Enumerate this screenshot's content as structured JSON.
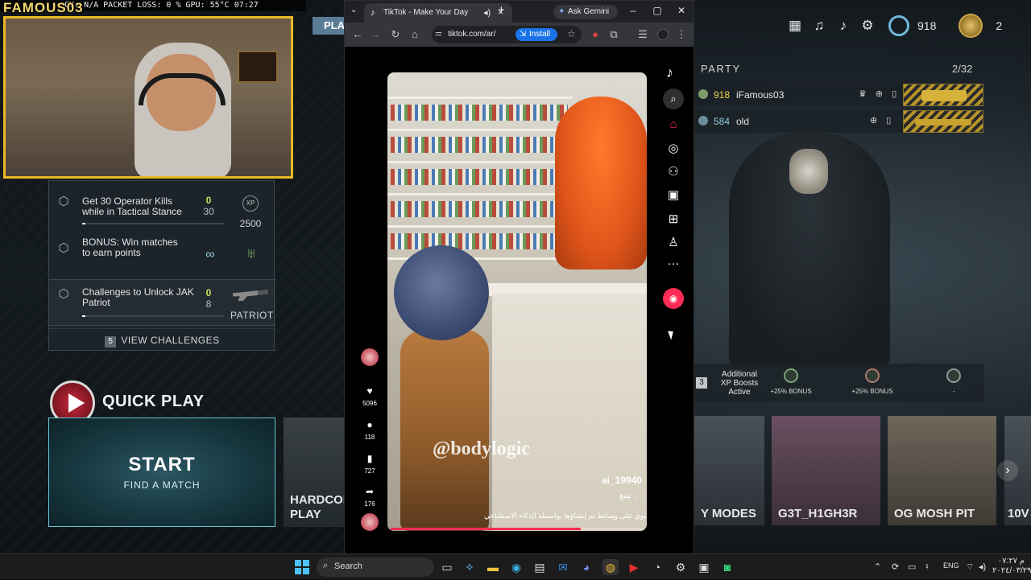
{
  "stream": {
    "stats": "CY: N/A    PACKET LOSS: 0 %    GPU: 55°C    07:27",
    "streamer": "FAMOUS03",
    "play_tab": "PLAY"
  },
  "challenges": {
    "items": [
      {
        "title": "Get 30 Operator Kills while in Tactical Stance",
        "current": "0",
        "total": "30",
        "reward": "2500"
      },
      {
        "title": "BONUS: Win matches to earn points",
        "current": "",
        "total": "",
        "reward": "∞"
      },
      {
        "title": "Challenges to Unlock JAK Patriot",
        "current": "0",
        "total": "8",
        "reward": "PATRIOT"
      }
    ],
    "view_count": "5",
    "view_label": "VIEW CHALLENGES"
  },
  "quick_play": {
    "title": "QUICK PLAY",
    "start": "START",
    "sub": "FIND A MATCH",
    "hardcore": "HARDCORE PLAY"
  },
  "hud": {
    "level": "918",
    "prestige": "2"
  },
  "party": {
    "label": "PARTY",
    "count": "2/32",
    "members": [
      {
        "level": "918",
        "name": "iFamous03"
      },
      {
        "level": "584",
        "name": "old"
      }
    ]
  },
  "xp_boosts": {
    "count": "3",
    "label": "Additional XP Boosts Active",
    "slots": [
      "+25% BONUS",
      "+25% BONUS",
      "-"
    ]
  },
  "playlists": [
    "Y MODES",
    "G3T_H1GH3R",
    "OG MOSH PIT",
    "10V"
  ],
  "browser": {
    "tab_title": "TikTok - Make Your Day",
    "gemini": "Ask Gemini",
    "url": "tiktok.com/ar/",
    "install": "Install"
  },
  "tiktok": {
    "watermark": "@bodylogic",
    "username": "ai_19940",
    "follow": "يتبع ..",
    "caption": "يحتوي على وسائط تم إنشاؤها بواسطة الذكاء الاصطناعي",
    "likes": "5096",
    "comments": "118",
    "saves": "727",
    "shares": "176",
    "progress": 0.75
  },
  "taskbar": {
    "search": "Search",
    "lang": "ENG",
    "time": "۰۷:۲۷ م",
    "date": "٢٠٢٤/٠٣/٢٩"
  }
}
